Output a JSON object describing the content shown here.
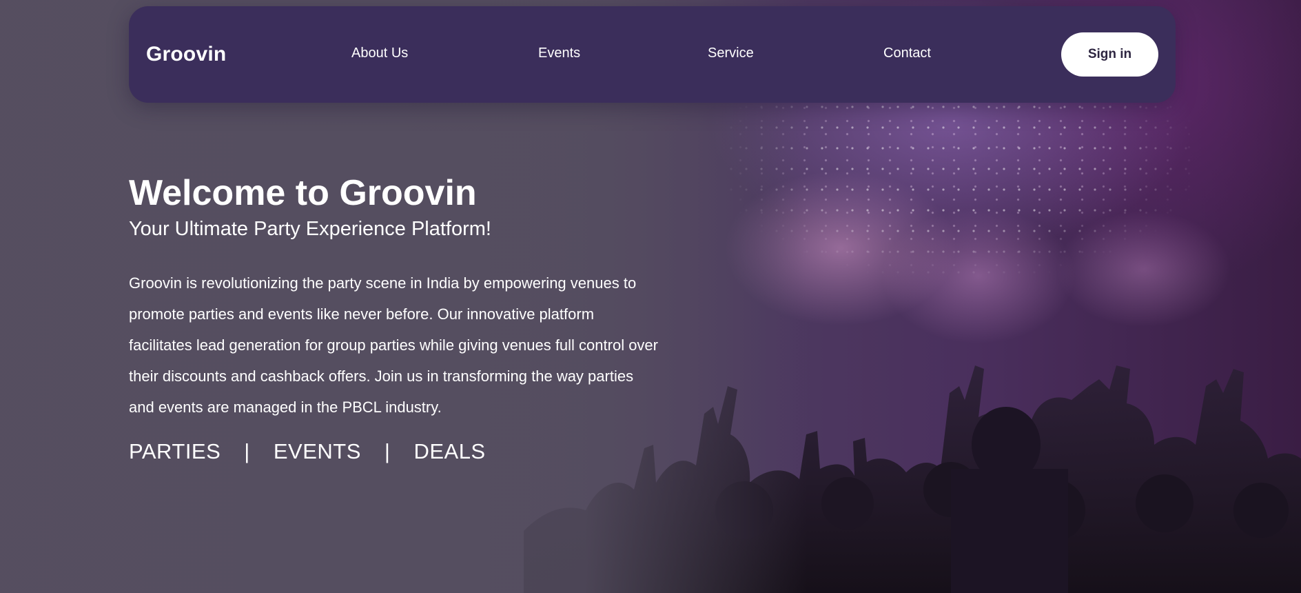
{
  "nav": {
    "logo": "Groovin",
    "links": [
      {
        "label": "About Us"
      },
      {
        "label": "Events"
      },
      {
        "label": "Service"
      },
      {
        "label": "Contact"
      }
    ],
    "signin_label": "Sign in"
  },
  "hero": {
    "title": "Welcome to Groovin",
    "subtitle": "Your Ultimate Party Experience Platform!",
    "description": "Groovin is revolutionizing the party scene in India by empowering venues to promote parties and events like never before. Our innovative platform facilitates lead generation for group parties while giving venues full control over their discounts and cashback offers. Join us in transforming the way parties and events are managed in the PBCL industry.",
    "tags": [
      "PARTIES",
      "EVENTS",
      "DEALS"
    ],
    "separator": "|"
  },
  "colors": {
    "nav_bg": "#3b2e5b",
    "signin_bg": "#ffffff",
    "text": "#ffffff"
  }
}
